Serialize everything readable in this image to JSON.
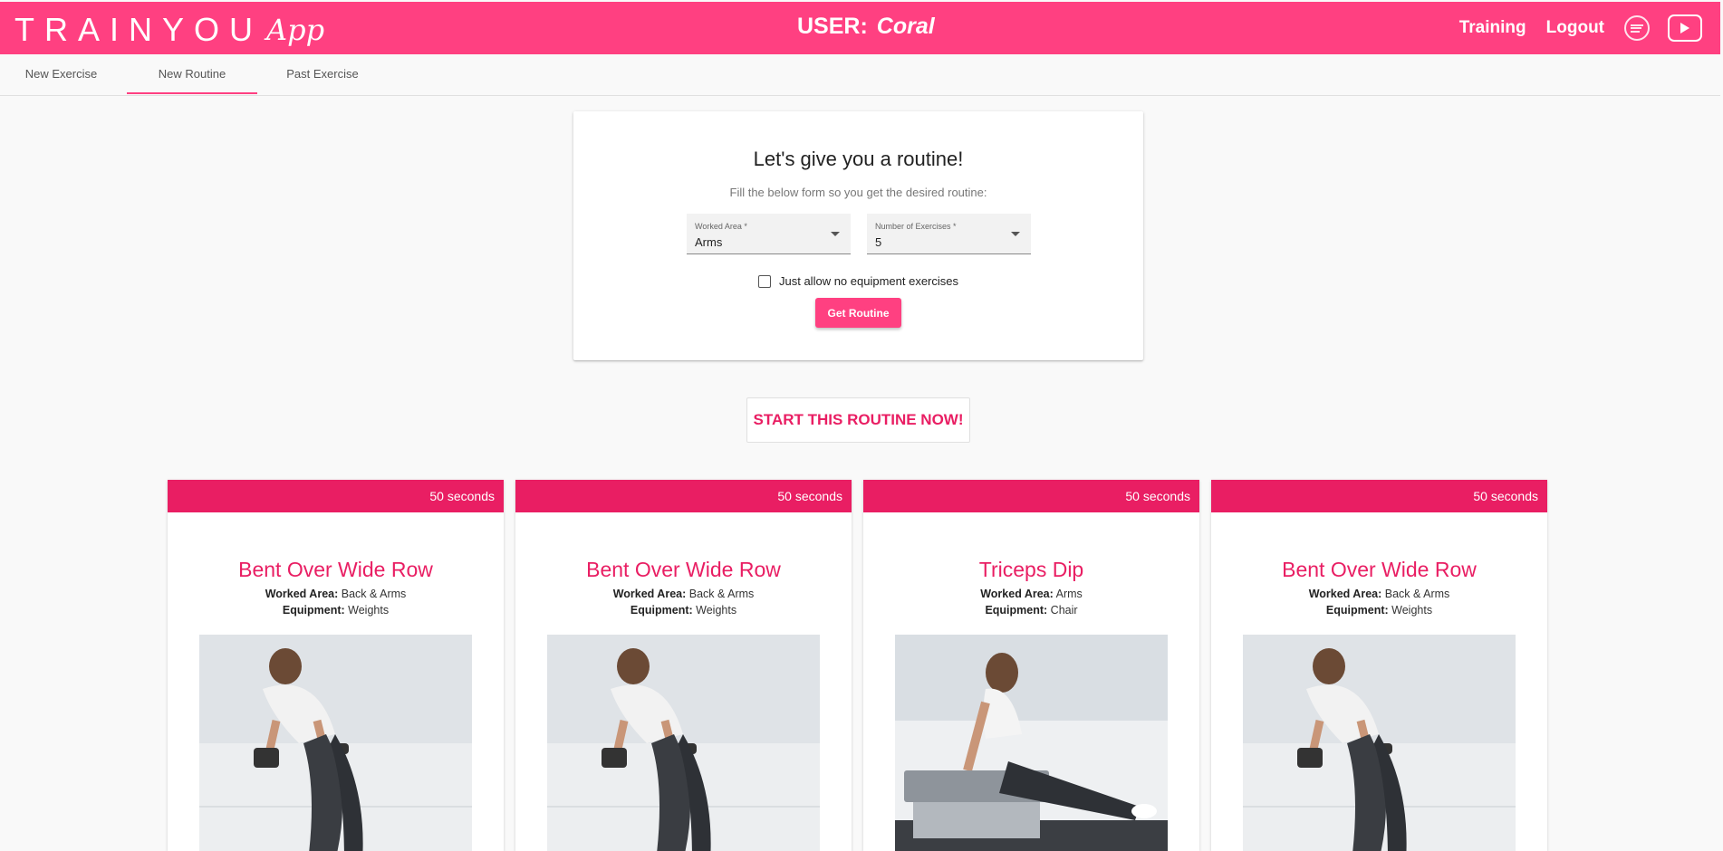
{
  "header": {
    "logo_text": "TRAINYOU",
    "logo_script": "App",
    "user_label": "USER:",
    "user_name": "Coral",
    "nav": [
      "Training",
      "Logout"
    ],
    "icons": [
      "spotify-icon",
      "youtube-icon"
    ]
  },
  "tabs": [
    {
      "label": "New Exercise",
      "active": false
    },
    {
      "label": "New Routine",
      "active": true
    },
    {
      "label": "Past Exercise",
      "active": false
    }
  ],
  "form": {
    "title": "Let's give you a routine!",
    "subtitle": "Fill the below form so you get the desired routine:",
    "worked_area": {
      "label": "Worked Area *",
      "value": "Arms"
    },
    "num_exercises": {
      "label": "Number of Exercises *",
      "value": "5"
    },
    "checkbox_label": "Just allow no equipment exercises",
    "checkbox_checked": false,
    "submit_label": "Get Routine"
  },
  "start_label": "START THIS ROUTINE NOW!",
  "exercises": [
    {
      "duration": "50 seconds",
      "name": "Bent Over Wide Row",
      "area_label": "Worked Area:",
      "area": "Back & Arms",
      "equip_label": "Equipment:",
      "equipment": "Weights",
      "image": "bent-over-row-photo"
    },
    {
      "duration": "50 seconds",
      "name": "Bent Over Wide Row",
      "area_label": "Worked Area:",
      "area": "Back & Arms",
      "equip_label": "Equipment:",
      "equipment": "Weights",
      "image": "bent-over-row-photo"
    },
    {
      "duration": "50 seconds",
      "name": "Triceps Dip",
      "area_label": "Worked Area:",
      "area": "Arms",
      "equip_label": "Equipment:",
      "equipment": "Chair",
      "image": "triceps-dip-photo"
    },
    {
      "duration": "50 seconds",
      "name": "Bent Over Wide Row",
      "area_label": "Worked Area:",
      "area": "Back & Arms",
      "equip_label": "Equipment:",
      "equipment": "Weights",
      "image": "bent-over-row-photo"
    }
  ],
  "colors": {
    "primary": "#ff4081",
    "accent": "#e91e63",
    "background": "#f9f9f9"
  }
}
